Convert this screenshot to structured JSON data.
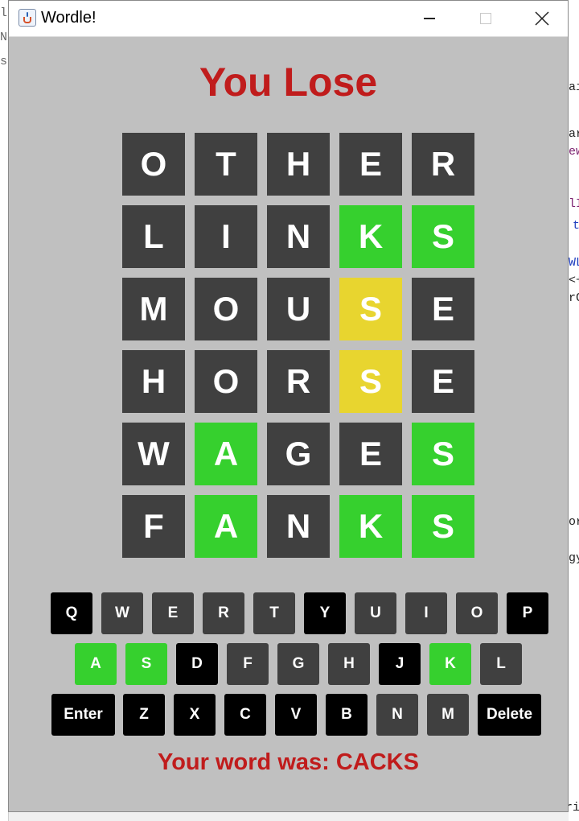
{
  "window": {
    "title": "Wordle!"
  },
  "heading": "You Lose",
  "colors": {
    "gray": "#404040",
    "green": "#36d02e",
    "yellow": "#e8d52f",
    "black": "#000000",
    "red": "#c01c1c",
    "background": "#c0c0c0"
  },
  "board": [
    [
      {
        "l": "O",
        "s": "gray"
      },
      {
        "l": "T",
        "s": "gray"
      },
      {
        "l": "H",
        "s": "gray"
      },
      {
        "l": "E",
        "s": "gray"
      },
      {
        "l": "R",
        "s": "gray"
      }
    ],
    [
      {
        "l": "L",
        "s": "gray"
      },
      {
        "l": "I",
        "s": "gray"
      },
      {
        "l": "N",
        "s": "gray"
      },
      {
        "l": "K",
        "s": "green"
      },
      {
        "l": "S",
        "s": "green"
      }
    ],
    [
      {
        "l": "M",
        "s": "gray"
      },
      {
        "l": "O",
        "s": "gray"
      },
      {
        "l": "U",
        "s": "gray"
      },
      {
        "l": "S",
        "s": "yellow"
      },
      {
        "l": "E",
        "s": "gray"
      }
    ],
    [
      {
        "l": "H",
        "s": "gray"
      },
      {
        "l": "O",
        "s": "gray"
      },
      {
        "l": "R",
        "s": "gray"
      },
      {
        "l": "S",
        "s": "yellow"
      },
      {
        "l": "E",
        "s": "gray"
      }
    ],
    [
      {
        "l": "W",
        "s": "gray"
      },
      {
        "l": "A",
        "s": "green"
      },
      {
        "l": "G",
        "s": "gray"
      },
      {
        "l": "E",
        "s": "gray"
      },
      {
        "l": "S",
        "s": "green"
      }
    ],
    [
      {
        "l": "F",
        "s": "gray"
      },
      {
        "l": "A",
        "s": "green"
      },
      {
        "l": "N",
        "s": "gray"
      },
      {
        "l": "K",
        "s": "green"
      },
      {
        "l": "S",
        "s": "green"
      }
    ]
  ],
  "keyboard": [
    [
      {
        "k": "Q",
        "s": "black"
      },
      {
        "k": "W",
        "s": "gray"
      },
      {
        "k": "E",
        "s": "gray"
      },
      {
        "k": "R",
        "s": "gray"
      },
      {
        "k": "T",
        "s": "gray"
      },
      {
        "k": "Y",
        "s": "black"
      },
      {
        "k": "U",
        "s": "gray"
      },
      {
        "k": "I",
        "s": "gray"
      },
      {
        "k": "O",
        "s": "gray"
      },
      {
        "k": "P",
        "s": "black"
      }
    ],
    [
      {
        "k": "A",
        "s": "green"
      },
      {
        "k": "S",
        "s": "green"
      },
      {
        "k": "D",
        "s": "black"
      },
      {
        "k": "F",
        "s": "gray"
      },
      {
        "k": "G",
        "s": "gray"
      },
      {
        "k": "H",
        "s": "gray"
      },
      {
        "k": "J",
        "s": "black"
      },
      {
        "k": "K",
        "s": "green"
      },
      {
        "k": "L",
        "s": "gray"
      }
    ],
    [
      {
        "k": "Enter",
        "s": "black"
      },
      {
        "k": "Z",
        "s": "black"
      },
      {
        "k": "X",
        "s": "black"
      },
      {
        "k": "C",
        "s": "black"
      },
      {
        "k": "V",
        "s": "black"
      },
      {
        "k": "B",
        "s": "black"
      },
      {
        "k": "N",
        "s": "gray"
      },
      {
        "k": "M",
        "s": "gray"
      },
      {
        "k": "Delete",
        "s": "black"
      }
    ]
  ],
  "answer_text": "Your word was: CACKS",
  "background_fragments": {
    "left": [
      "le",
      "N",
      "s"
    ],
    "right": [
      "ai",
      "ar",
      "ew",
      "lI",
      "t",
      "WL",
      "<+",
      "rC",
      "or",
      "gy",
      "Wri"
    ]
  }
}
